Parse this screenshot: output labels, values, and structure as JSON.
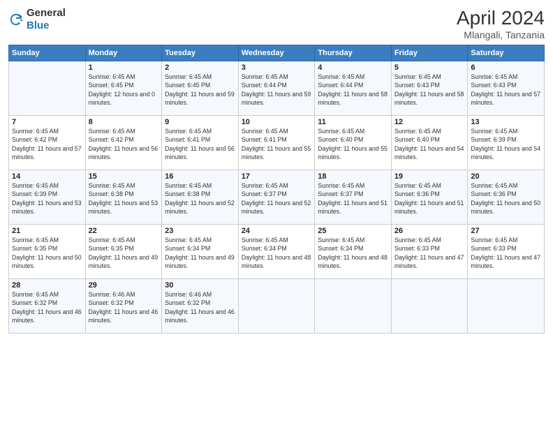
{
  "header": {
    "logo_general": "General",
    "logo_blue": "Blue",
    "month": "April 2024",
    "location": "Mlangali, Tanzania"
  },
  "days_of_week": [
    "Sunday",
    "Monday",
    "Tuesday",
    "Wednesday",
    "Thursday",
    "Friday",
    "Saturday"
  ],
  "weeks": [
    [
      {
        "day": "",
        "sunrise": "",
        "sunset": "",
        "daylight": ""
      },
      {
        "day": "1",
        "sunrise": "Sunrise: 6:45 AM",
        "sunset": "Sunset: 6:45 PM",
        "daylight": "Daylight: 12 hours and 0 minutes."
      },
      {
        "day": "2",
        "sunrise": "Sunrise: 6:45 AM",
        "sunset": "Sunset: 6:45 PM",
        "daylight": "Daylight: 11 hours and 59 minutes."
      },
      {
        "day": "3",
        "sunrise": "Sunrise: 6:45 AM",
        "sunset": "Sunset: 6:44 PM",
        "daylight": "Daylight: 11 hours and 59 minutes."
      },
      {
        "day": "4",
        "sunrise": "Sunrise: 6:45 AM",
        "sunset": "Sunset: 6:44 PM",
        "daylight": "Daylight: 11 hours and 58 minutes."
      },
      {
        "day": "5",
        "sunrise": "Sunrise: 6:45 AM",
        "sunset": "Sunset: 6:43 PM",
        "daylight": "Daylight: 11 hours and 58 minutes."
      },
      {
        "day": "6",
        "sunrise": "Sunrise: 6:45 AM",
        "sunset": "Sunset: 6:43 PM",
        "daylight": "Daylight: 11 hours and 57 minutes."
      }
    ],
    [
      {
        "day": "7",
        "sunrise": "Sunrise: 6:45 AM",
        "sunset": "Sunset: 6:42 PM",
        "daylight": "Daylight: 11 hours and 57 minutes."
      },
      {
        "day": "8",
        "sunrise": "Sunrise: 6:45 AM",
        "sunset": "Sunset: 6:42 PM",
        "daylight": "Daylight: 11 hours and 56 minutes."
      },
      {
        "day": "9",
        "sunrise": "Sunrise: 6:45 AM",
        "sunset": "Sunset: 6:41 PM",
        "daylight": "Daylight: 11 hours and 56 minutes."
      },
      {
        "day": "10",
        "sunrise": "Sunrise: 6:45 AM",
        "sunset": "Sunset: 6:41 PM",
        "daylight": "Daylight: 11 hours and 55 minutes."
      },
      {
        "day": "11",
        "sunrise": "Sunrise: 6:45 AM",
        "sunset": "Sunset: 6:40 PM",
        "daylight": "Daylight: 11 hours and 55 minutes."
      },
      {
        "day": "12",
        "sunrise": "Sunrise: 6:45 AM",
        "sunset": "Sunset: 6:40 PM",
        "daylight": "Daylight: 11 hours and 54 minutes."
      },
      {
        "day": "13",
        "sunrise": "Sunrise: 6:45 AM",
        "sunset": "Sunset: 6:39 PM",
        "daylight": "Daylight: 11 hours and 54 minutes."
      }
    ],
    [
      {
        "day": "14",
        "sunrise": "Sunrise: 6:45 AM",
        "sunset": "Sunset: 6:39 PM",
        "daylight": "Daylight: 11 hours and 53 minutes."
      },
      {
        "day": "15",
        "sunrise": "Sunrise: 6:45 AM",
        "sunset": "Sunset: 6:38 PM",
        "daylight": "Daylight: 11 hours and 53 minutes."
      },
      {
        "day": "16",
        "sunrise": "Sunrise: 6:45 AM",
        "sunset": "Sunset: 6:38 PM",
        "daylight": "Daylight: 11 hours and 52 minutes."
      },
      {
        "day": "17",
        "sunrise": "Sunrise: 6:45 AM",
        "sunset": "Sunset: 6:37 PM",
        "daylight": "Daylight: 11 hours and 52 minutes."
      },
      {
        "day": "18",
        "sunrise": "Sunrise: 6:45 AM",
        "sunset": "Sunset: 6:37 PM",
        "daylight": "Daylight: 11 hours and 51 minutes."
      },
      {
        "day": "19",
        "sunrise": "Sunrise: 6:45 AM",
        "sunset": "Sunset: 6:36 PM",
        "daylight": "Daylight: 11 hours and 51 minutes."
      },
      {
        "day": "20",
        "sunrise": "Sunrise: 6:45 AM",
        "sunset": "Sunset: 6:36 PM",
        "daylight": "Daylight: 11 hours and 50 minutes."
      }
    ],
    [
      {
        "day": "21",
        "sunrise": "Sunrise: 6:45 AM",
        "sunset": "Sunset: 6:35 PM",
        "daylight": "Daylight: 11 hours and 50 minutes."
      },
      {
        "day": "22",
        "sunrise": "Sunrise: 6:45 AM",
        "sunset": "Sunset: 6:35 PM",
        "daylight": "Daylight: 11 hours and 49 minutes."
      },
      {
        "day": "23",
        "sunrise": "Sunrise: 6:45 AM",
        "sunset": "Sunset: 6:34 PM",
        "daylight": "Daylight: 11 hours and 49 minutes."
      },
      {
        "day": "24",
        "sunrise": "Sunrise: 6:45 AM",
        "sunset": "Sunset: 6:34 PM",
        "daylight": "Daylight: 11 hours and 48 minutes."
      },
      {
        "day": "25",
        "sunrise": "Sunrise: 6:45 AM",
        "sunset": "Sunset: 6:34 PM",
        "daylight": "Daylight: 11 hours and 48 minutes."
      },
      {
        "day": "26",
        "sunrise": "Sunrise: 6:45 AM",
        "sunset": "Sunset: 6:33 PM",
        "daylight": "Daylight: 11 hours and 47 minutes."
      },
      {
        "day": "27",
        "sunrise": "Sunrise: 6:45 AM",
        "sunset": "Sunset: 6:33 PM",
        "daylight": "Daylight: 11 hours and 47 minutes."
      }
    ],
    [
      {
        "day": "28",
        "sunrise": "Sunrise: 6:45 AM",
        "sunset": "Sunset: 6:32 PM",
        "daylight": "Daylight: 11 hours and 46 minutes."
      },
      {
        "day": "29",
        "sunrise": "Sunrise: 6:46 AM",
        "sunset": "Sunset: 6:32 PM",
        "daylight": "Daylight: 11 hours and 46 minutes."
      },
      {
        "day": "30",
        "sunrise": "Sunrise: 6:46 AM",
        "sunset": "Sunset: 6:32 PM",
        "daylight": "Daylight: 11 hours and 46 minutes."
      },
      {
        "day": "",
        "sunrise": "",
        "sunset": "",
        "daylight": ""
      },
      {
        "day": "",
        "sunrise": "",
        "sunset": "",
        "daylight": ""
      },
      {
        "day": "",
        "sunrise": "",
        "sunset": "",
        "daylight": ""
      },
      {
        "day": "",
        "sunrise": "",
        "sunset": "",
        "daylight": ""
      }
    ]
  ]
}
